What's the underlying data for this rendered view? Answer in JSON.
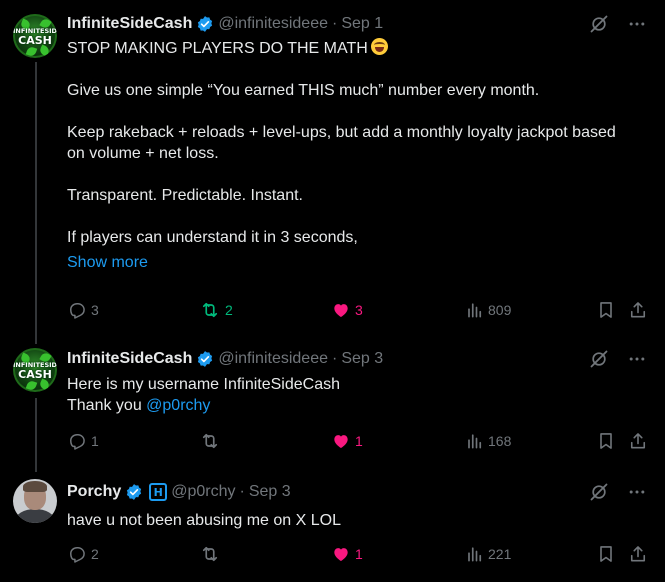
{
  "colors": {
    "background": "#000000",
    "text": "#e7e9ea",
    "muted": "#71767b",
    "link": "#1d9bf0",
    "retweet_active": "#00ba7c",
    "like_active": "#f91880",
    "verified": "#1d9bf0",
    "thread_line": "#333639"
  },
  "posts": [
    {
      "author": {
        "display_name": "InfiniteSideCash",
        "handle": "@infinitesideee",
        "verified": true,
        "avatar_text_top": "INFINITESIDE",
        "avatar_text_bottom": "CASH"
      },
      "separator": "·",
      "date": "Sep 1",
      "text": {
        "line1": "STOP MAKING PLAYERS DO THE MATH",
        "emoji": "laughing-with-tears-emoji",
        "line2": "Give us one simple “You earned THIS much” number every month.",
        "line3a": "Keep rakeback + reloads + level-ups, but add a monthly loyalty jackpot based",
        "line3b": "on volume + net loss.",
        "line4": "Transparent. Predictable. Instant.",
        "line5": "If players can understand it in 3 seconds,",
        "show_more": "Show more"
      },
      "stats": {
        "replies": "3",
        "reposts": "2",
        "likes": "3",
        "views": "809"
      },
      "state": {
        "reposted": true,
        "liked": true
      }
    },
    {
      "author": {
        "display_name": "InfiniteSideCash",
        "handle": "@infinitesideee",
        "verified": true,
        "avatar_text_top": "INFINITESIDE",
        "avatar_text_bottom": "CASH"
      },
      "separator": "·",
      "date": "Sep 3",
      "text": {
        "line1": "Here is my username InfiniteSideCash",
        "line2_prefix": "Thank you ",
        "mention": "@p0rchy"
      },
      "stats": {
        "replies": "1",
        "reposts": "",
        "likes": "1",
        "views": "168"
      },
      "state": {
        "reposted": false,
        "liked": true
      }
    },
    {
      "author": {
        "display_name": "Porchy",
        "handle": "@p0rchy",
        "verified": true,
        "affiliate_badge": "H"
      },
      "separator": "·",
      "date": "Sep 3",
      "text": {
        "line1": "have u not been abusing me on X LOL"
      },
      "stats": {
        "replies": "2",
        "reposts": "",
        "likes": "1",
        "views": "221"
      },
      "state": {
        "reposted": false,
        "liked": true
      }
    }
  ],
  "icons": {
    "grok": "grok-icon",
    "more": "more-options-icon",
    "reply": "reply-icon",
    "repost": "repost-icon",
    "like": "heart-icon",
    "views": "views-icon",
    "bookmark": "bookmark-icon",
    "share": "share-icon"
  }
}
